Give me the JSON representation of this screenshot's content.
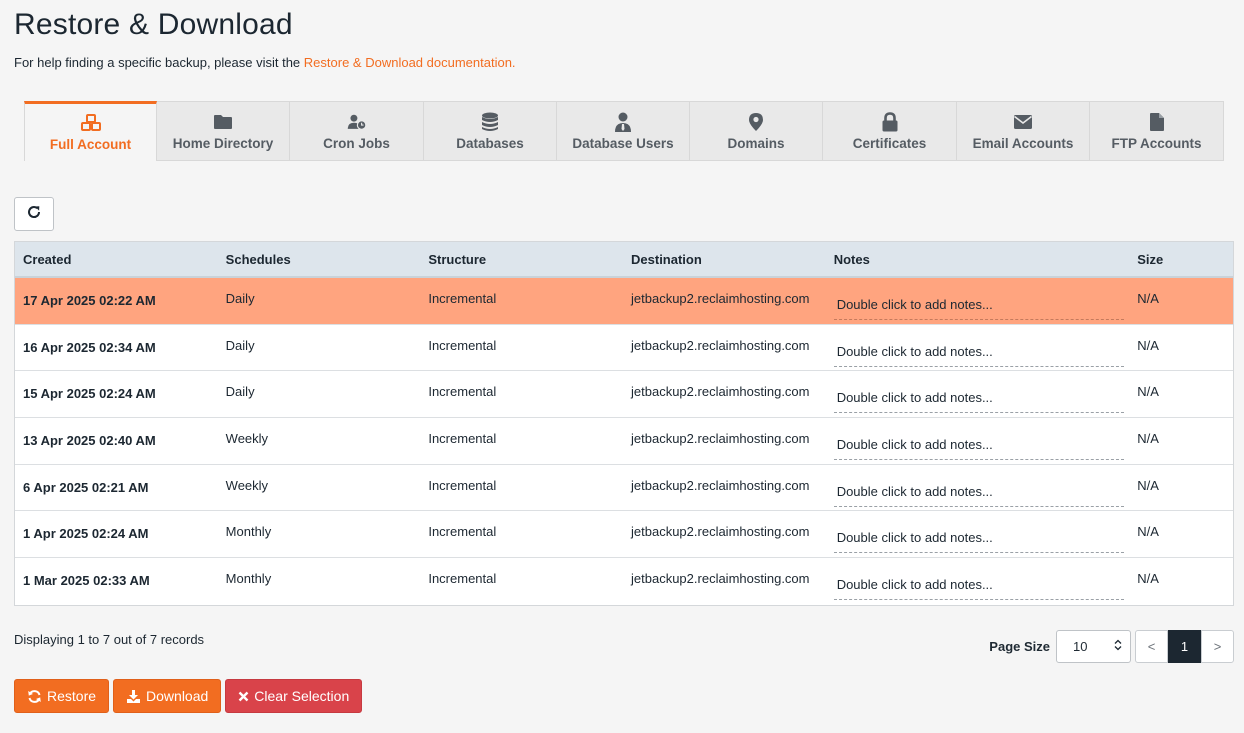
{
  "page": {
    "title": "Restore & Download",
    "help_prefix": "For help finding a specific backup, please visit the",
    "help_link": "Restore & Download documentation."
  },
  "tabs": [
    {
      "label": "Full Account",
      "icon": "cubes-icon",
      "active": true
    },
    {
      "label": "Home Directory",
      "icon": "folder-icon",
      "active": false
    },
    {
      "label": "Cron Jobs",
      "icon": "user-clock-icon",
      "active": false
    },
    {
      "label": "Databases",
      "icon": "database-icon",
      "active": false
    },
    {
      "label": "Database Users",
      "icon": "user-tie-icon",
      "active": false
    },
    {
      "label": "Domains",
      "icon": "map-marker-icon",
      "active": false
    },
    {
      "label": "Certificates",
      "icon": "lock-icon",
      "active": false
    },
    {
      "label": "Email Accounts",
      "icon": "envelope-icon",
      "active": false
    },
    {
      "label": "FTP Accounts",
      "icon": "file-icon",
      "active": false
    }
  ],
  "table": {
    "headers": {
      "created": "Created",
      "schedules": "Schedules",
      "structure": "Structure",
      "destination": "Destination",
      "notes": "Notes",
      "size": "Size"
    },
    "rows": [
      {
        "created": "17 Apr 2025 02:22 AM",
        "schedules": "Daily",
        "structure": "Incremental",
        "destination": "jetbackup2.reclaimhosting.com",
        "notes": "Double click to add notes...",
        "size": "N/A",
        "selected": true
      },
      {
        "created": "16 Apr 2025 02:34 AM",
        "schedules": "Daily",
        "structure": "Incremental",
        "destination": "jetbackup2.reclaimhosting.com",
        "notes": "Double click to add notes...",
        "size": "N/A",
        "selected": false
      },
      {
        "created": "15 Apr 2025 02:24 AM",
        "schedules": "Daily",
        "structure": "Incremental",
        "destination": "jetbackup2.reclaimhosting.com",
        "notes": "Double click to add notes...",
        "size": "N/A",
        "selected": false
      },
      {
        "created": "13 Apr 2025 02:40 AM",
        "schedules": "Weekly",
        "structure": "Incremental",
        "destination": "jetbackup2.reclaimhosting.com",
        "notes": "Double click to add notes...",
        "size": "N/A",
        "selected": false
      },
      {
        "created": "6 Apr 2025 02:21 AM",
        "schedules": "Weekly",
        "structure": "Incremental",
        "destination": "jetbackup2.reclaimhosting.com",
        "notes": "Double click to add notes...",
        "size": "N/A",
        "selected": false
      },
      {
        "created": "1 Apr 2025 02:24 AM",
        "schedules": "Monthly",
        "structure": "Incremental",
        "destination": "jetbackup2.reclaimhosting.com",
        "notes": "Double click to add notes...",
        "size": "N/A",
        "selected": false
      },
      {
        "created": "1 Mar 2025 02:33 AM",
        "schedules": "Monthly",
        "structure": "Incremental",
        "destination": "jetbackup2.reclaimhosting.com",
        "notes": "Double click to add notes...",
        "size": "N/A",
        "selected": false
      }
    ]
  },
  "footer": {
    "records_text": "Displaying 1 to 7 out of 7 records",
    "page_size_label": "Page Size",
    "page_size_value": "10",
    "prev_label": "<",
    "current_page": "1",
    "next_label": ">"
  },
  "actions": {
    "restore_label": "Restore",
    "download_label": "Download",
    "clear_label": "Clear Selection"
  },
  "colors": {
    "accent": "#f26d21",
    "selected_row": "#ffa47f",
    "danger": "#d9434a",
    "header_bg": "#dde5ec"
  }
}
